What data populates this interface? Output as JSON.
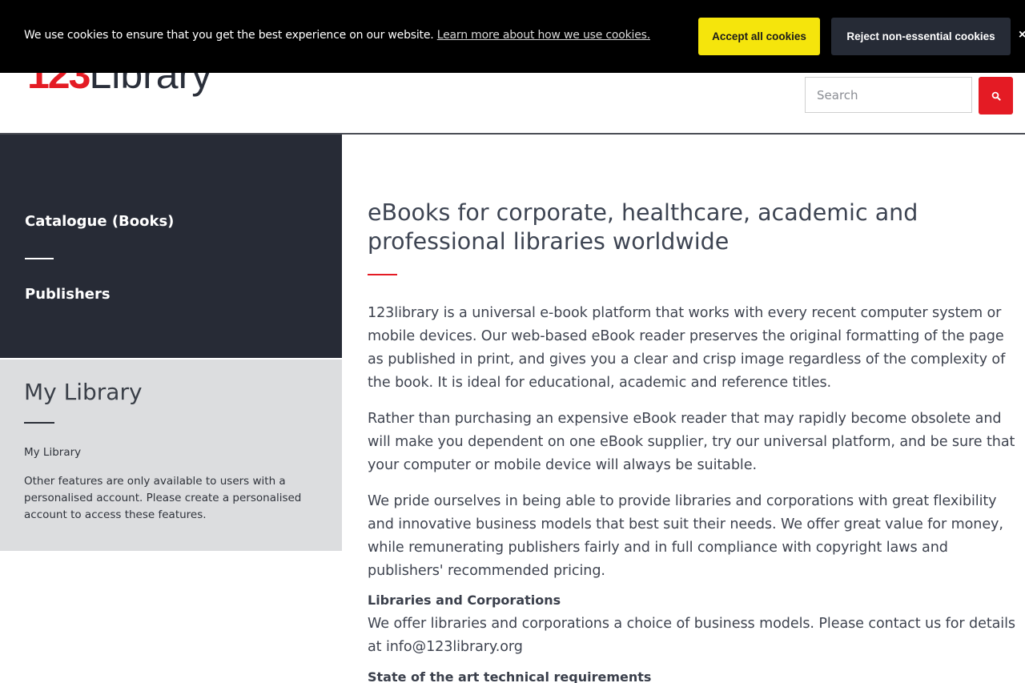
{
  "cookie_banner": {
    "message": "We use cookies to ensure that you get the best experience on our website.",
    "link_text": "Learn more about how we use cookies.",
    "accept_label": "Accept all cookies",
    "reject_label": "Reject non-essential cookies",
    "close_label": "×"
  },
  "header": {
    "logo_number": "123",
    "logo_word": "Library",
    "search_placeholder": "Search"
  },
  "sidebar": {
    "nav_items": [
      {
        "label": "Catalogue (Books)"
      },
      {
        "label": "Publishers"
      }
    ],
    "my_library": {
      "title": "My Library",
      "link_label": "My Library",
      "note": "Other features are only available to users with a personalised account. Please create a personalised account to access these features."
    }
  },
  "main": {
    "title": "eBooks for corporate, healthcare, academic and professional libraries worldwide",
    "paragraphs": [
      "123library is a universal e-book platform that works with every recent computer system or mobile devices. Our web-based eBook reader preserves the original formatting of the page as published in print, and gives you a clear and crisp image regardless of the complexity of the book. It is ideal for educational, academic and reference titles.",
      "Rather than purchasing an expensive eBook reader that may rapidly become obsolete and will make you dependent on one eBook supplier, try our universal platform, and be sure that your computer or mobile device will always be suitable.",
      "We pride ourselves in being able to provide libraries and corporations with great flexibility and innovative business models that best suit their needs. We offer great value for money, while remunerating publishers fairly and in full compliance with copyright laws and publishers' recommended pricing."
    ],
    "libraries_heading": "Libraries and Corporations",
    "libraries_text": "We offer libraries and corporations a choice of business models. Please contact us for details at info@123library.org",
    "tech_heading": "State of the art technical requirements"
  },
  "colors": {
    "brand_red": "#e41b24",
    "cookie_accept": "#f5e50c",
    "sidebar_dark": "#272b36",
    "sidebar_light": "#dcdddf"
  }
}
